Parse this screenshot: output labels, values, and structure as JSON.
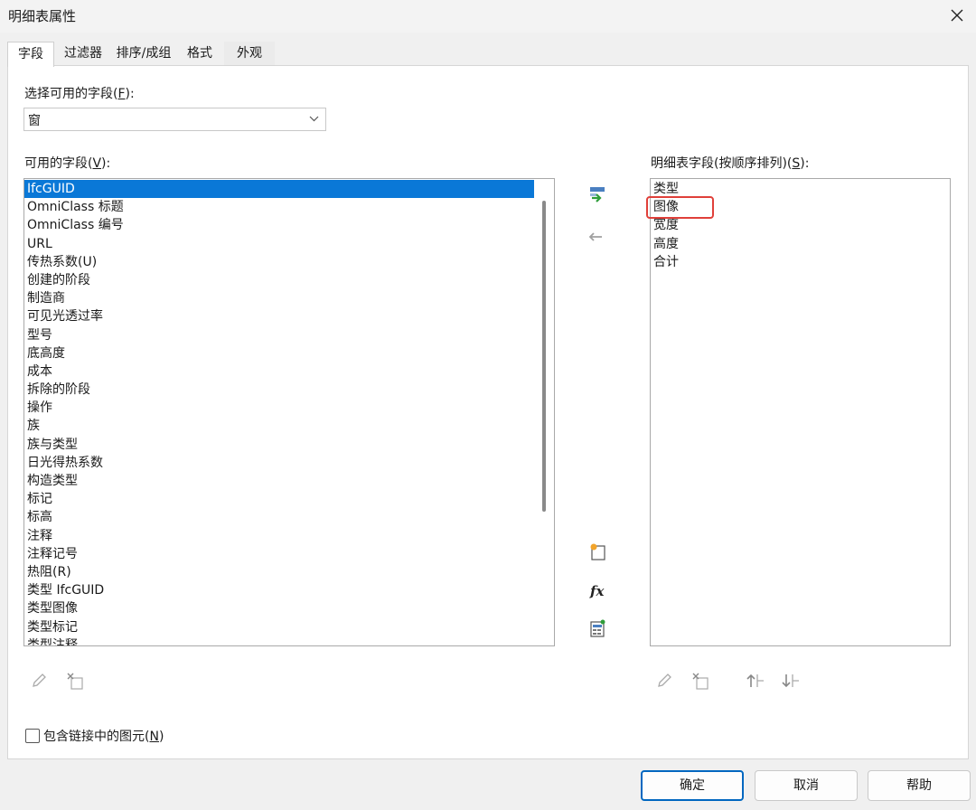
{
  "window": {
    "title": "明细表属性"
  },
  "tabs": [
    {
      "label": "字段"
    },
    {
      "label": "过滤器"
    },
    {
      "label": "排序/成组"
    },
    {
      "label": "格式"
    },
    {
      "label": "外观"
    }
  ],
  "select_fields": {
    "label_prefix": "选择可用的字段(",
    "label_key": "F",
    "label_suffix": "):",
    "value": "窗"
  },
  "available": {
    "label_prefix": "可用的字段(",
    "label_key": "V",
    "label_suffix": "):",
    "items": [
      "IfcGUID",
      "OmniClass 标题",
      "OmniClass 编号",
      "URL",
      "传热系数(U)",
      "创建的阶段",
      "制造商",
      "可见光透过率",
      "型号",
      "底高度",
      "成本",
      "拆除的阶段",
      "操作",
      "族",
      "族与类型",
      "日光得热系数",
      "构造类型",
      "标记",
      "标高",
      "注释",
      "注释记号",
      "热阻(R)",
      "类型 IfcGUID",
      "类型图像",
      "类型标记",
      "类型注释"
    ],
    "selected_index": 0
  },
  "scheduled": {
    "label_prefix": "明细表字段(按顺序排列)(",
    "label_key": "S",
    "label_suffix": "):",
    "items": [
      "类型",
      "图像",
      "宽度",
      "高度",
      "合计"
    ]
  },
  "include_links": {
    "label_prefix": "包含链接中的图元(",
    "label_key": "N",
    "label_suffix": ")",
    "checked": false
  },
  "buttons": {
    "ok": "确定",
    "cancel": "取消",
    "help": "帮助"
  },
  "colors": {
    "selection": "#0a78d7",
    "highlight_box": "#e0403a",
    "accent": "#0067c0"
  }
}
